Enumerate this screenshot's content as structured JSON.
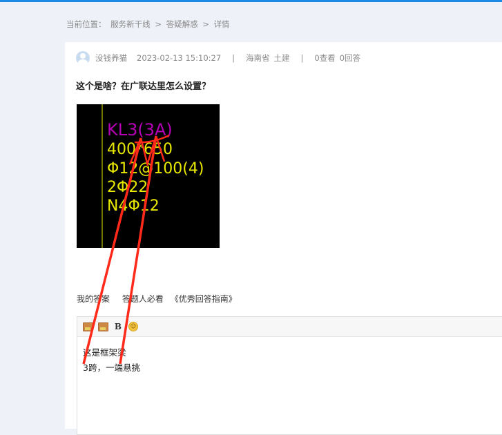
{
  "breadcrumb": {
    "prefix": "当前位置：",
    "items": [
      "服务新干线",
      "答疑解惑",
      "详情"
    ],
    "separator": ">"
  },
  "meta": {
    "username": "没钱养猫",
    "datetime": "2023-02-13 15:10:27",
    "region": "海南省",
    "category": "土建",
    "views": "0查看",
    "answers": "0回答"
  },
  "question": {
    "title": "这个是啥？在广联达里怎么设置？"
  },
  "cad": {
    "lines": [
      "KL3(3A)",
      "400*650",
      "Φ12@100(4)",
      "2Φ22",
      "N4Φ12"
    ],
    "line_colors": [
      "#b400b4",
      "#e8e800",
      "#e8e800",
      "#e8e800",
      "#e8e800"
    ],
    "background": "#000000"
  },
  "answer_tabs": {
    "my_answer": "我的答案",
    "must_read": "答题人必看",
    "guide": "《优秀回答指南》"
  },
  "editor": {
    "lines": [
      "这是框架梁",
      "3跨，一端悬挑"
    ]
  },
  "colors": {
    "accent": "#1e88e5",
    "annotation": "#ff2a1a"
  }
}
